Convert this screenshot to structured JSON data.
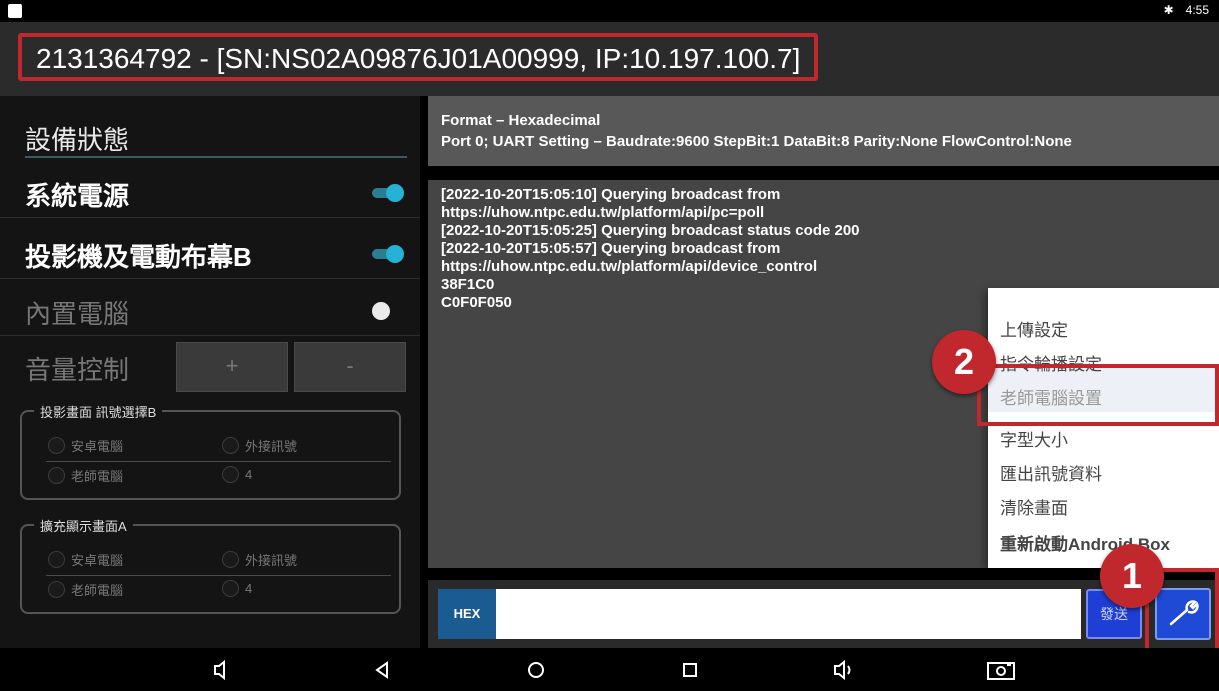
{
  "status_bar": {
    "bluetooth": "✱",
    "time": "4:55"
  },
  "header": {
    "title": "2131364792  - [SN:NS02A09876J01A00999, IP:10.197.100.7]"
  },
  "left_panel": {
    "section_title": "設備狀態",
    "rows": [
      {
        "label": "系統電源",
        "enabled": true,
        "on": true
      },
      {
        "label": "投影機及電動布幕B",
        "enabled": true,
        "on": true
      },
      {
        "label": "內置電腦",
        "enabled": false,
        "on": false
      }
    ],
    "volume": {
      "label": "音量控制",
      "plus": "+",
      "minus": "-"
    },
    "groups": [
      {
        "title": "投影畫面 訊號選擇B",
        "options": [
          "安卓電腦",
          "外接訊號",
          "老師電腦",
          "4"
        ]
      },
      {
        "title": "擴充顯示畫面A",
        "options": [
          "安卓電腦",
          "外接訊號",
          "老師電腦",
          "4"
        ]
      }
    ]
  },
  "format": {
    "line1": "Format – Hexadecimal",
    "line2": "Port 0; UART Setting – Baudrate:9600 StepBit:1 DataBit:8 Parity:None FlowControl:None"
  },
  "log": [
    "[2022-10-20T15:05:10] Querying broadcast from",
    "https://uhow.ntpc.edu.tw/platform/api/pc=poll",
    "[2022-10-20T15:05:25] Querying broadcast status code 200",
    "[2022-10-20T15:05:57] Querying broadcast from",
    "https://uhow.ntpc.edu.tw/platform/api/device_control",
    "38F1C0",
    "C0F0F050"
  ],
  "input_bar": {
    "hex_label": "HEX",
    "send_label": "發送",
    "value": ""
  },
  "menu": {
    "items": [
      "上傳設定",
      "指令輪播設定",
      "老師電腦設置",
      "字型大小",
      "匯出訊號資料",
      "清除畫面",
      "重新啟動Android Box"
    ]
  },
  "annotations": {
    "badge1": "1",
    "badge2": "2",
    "accent_color": "#c0282d"
  }
}
